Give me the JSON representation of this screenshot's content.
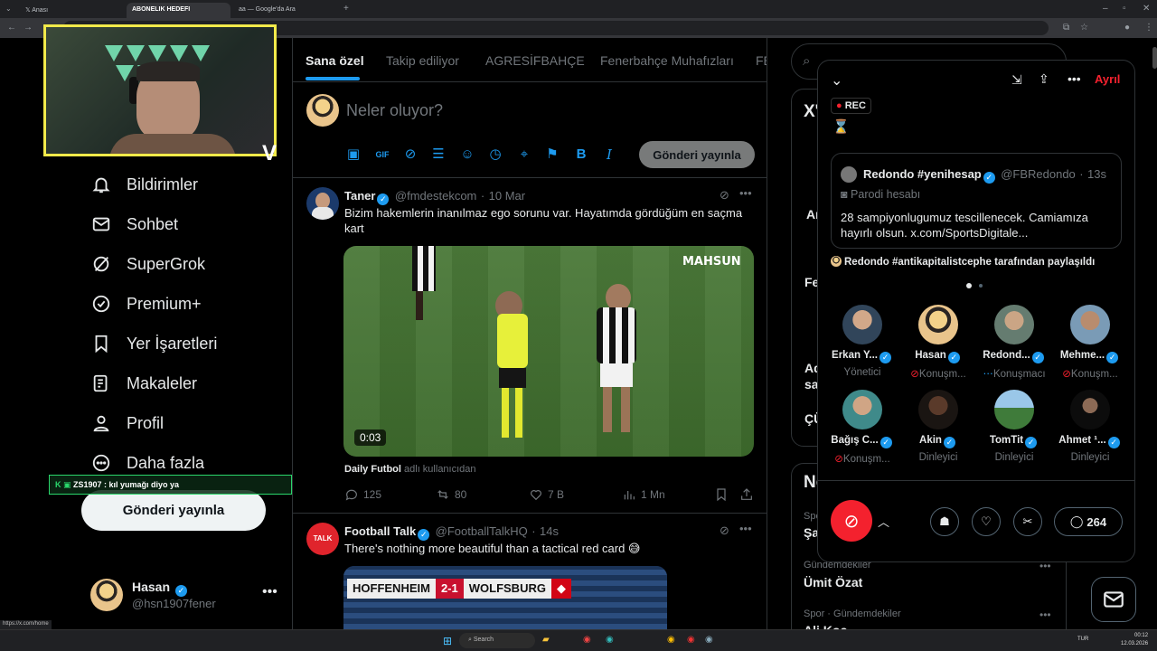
{
  "browser": {
    "tabs": [
      {
        "label": "Anası",
        "active": false
      },
      {
        "label": "ABONELIK HEDEFI",
        "active": true
      },
      {
        "label": "aa — Google'da Ara",
        "active": false
      }
    ]
  },
  "overlays": {
    "abonelik": "ABONELIK HEDEFI",
    "chat_line": "ZS1907 : kıl yumağı diyo ya"
  },
  "sidebar": {
    "items": [
      {
        "label": "Bildirimler",
        "icon": "bell-icon"
      },
      {
        "label": "Sohbet",
        "icon": "mail-icon"
      },
      {
        "label": "SuperGrok",
        "icon": "grok-icon"
      },
      {
        "label": "Premium+",
        "icon": "verified-icon"
      },
      {
        "label": "Yer İşaretleri",
        "icon": "bookmark-icon"
      },
      {
        "label": "Makaleler",
        "icon": "article-icon"
      },
      {
        "label": "Profil",
        "icon": "person-icon"
      },
      {
        "label": "Daha fazla",
        "icon": "more-circle-icon"
      }
    ],
    "post_button": "Gönderi yayınla",
    "profile": {
      "name": "Hasan",
      "handle": "@hsn1907fener"
    },
    "status_url": "https://x.com/home"
  },
  "feed": {
    "tabs": [
      "Sana özel",
      "Takip ediliyor",
      "AGRESİFBAHÇE",
      "Fenerbahçe Muhafızları",
      "FE"
    ],
    "compose": {
      "placeholder": "Neler oluyor?",
      "post_button": "Gönderi yayınla"
    },
    "tweets": [
      {
        "name": "Taner",
        "handle": "@fmdestekcom",
        "time": "10 Mar",
        "text": "Bizim hakemlerin inanılmaz ego sorunu var. Hayatımda gördüğüm en saçma kart",
        "video_watermark": "MAHSUN",
        "video_time": "0:03",
        "credit_user": "Daily Futbol",
        "credit_suffix": "adlı kullanıcıdan",
        "replies": "125",
        "reposts": "80",
        "likes": "7 B",
        "views": "1 Mn"
      },
      {
        "name": "Football Talk",
        "handle": "@FootballTalkHQ",
        "time": "14s",
        "text": "There's nothing more beautiful than a tactical red card 😅",
        "scoreboard": {
          "home": "HOFFENHEIM",
          "score": "2-1",
          "away": "WOLFSBURG"
        }
      }
    ]
  },
  "right": {
    "trends_partial": [
      "X'",
      "An",
      "Fe",
      "Ad",
      "sal",
      "ÇÜ"
    ],
    "news_heading": "Ne",
    "trend_items": [
      {
        "meta": "Spo",
        "title": "Şa"
      },
      {
        "meta": "Gündemdekiler",
        "title": "Ümit Özat"
      },
      {
        "meta": "Spor · Gündemdekiler",
        "title": "Ali Koç"
      }
    ]
  },
  "space": {
    "leave": "Ayrıl",
    "rec": "REC",
    "hourglass": "⌛",
    "pinned": {
      "name": "Redondo #yenihesap",
      "handle": "@FBRedondo",
      "time": "13s",
      "label": "Parodi hesabı",
      "text": "28 sampiyonlugumuz tescillenecek. Camiamıza hayırlı olsun. x.com/SportsDigitale..."
    },
    "shared_by": "Redondo #antikapitalistcephe tarafından paylaşıldı",
    "speakers": [
      {
        "name": "Erkan Y...",
        "role": "Yönetici"
      },
      {
        "name": "Hasan",
        "role": "Konuşm..."
      },
      {
        "name": "Redond...",
        "role": "Konuşmacı"
      },
      {
        "name": "Mehme...",
        "role": "Konuşm..."
      },
      {
        "name": "Bağış C...",
        "role": "Konuşm..."
      },
      {
        "name": "Akin",
        "role": "Dinleyici"
      },
      {
        "name": "TomTit",
        "role": "Dinleyici"
      },
      {
        "name": "Ahmet ¹...",
        "role": "Dinleyici"
      }
    ],
    "comment_count": "264"
  },
  "taskbar": {
    "search": "Search",
    "lang": "TUR",
    "time": "00:12",
    "date": "12.03.2026"
  }
}
